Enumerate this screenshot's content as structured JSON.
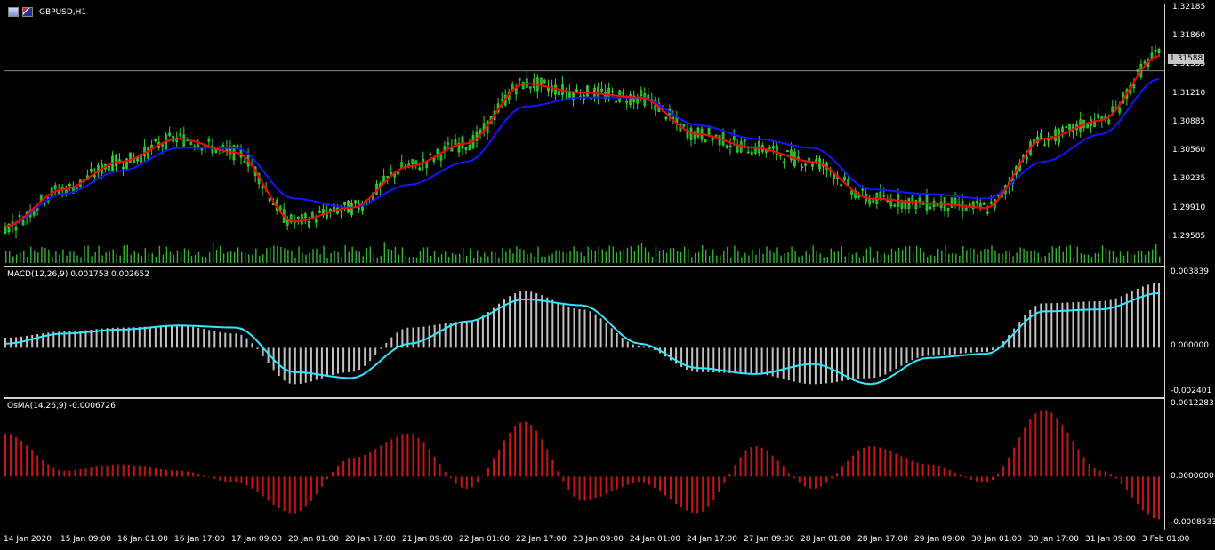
{
  "header": {
    "symbol_label": "GBPUSD,H1"
  },
  "icons": [
    "chart-window-icon",
    "uk-flag-icon"
  ],
  "colors": {
    "background": "#000000",
    "bull": "#33d633",
    "ma_fast": "#ff0000",
    "ma_slow": "#1515ff",
    "volume": "#2fb52f",
    "macd_hist": "#c0c0c0",
    "macd_signal": "#33e6ff",
    "osma": "#c81414",
    "grid_frame": "#d0d0d0"
  },
  "price_panel": {
    "current_price": "1.31588",
    "ticks": [
      "1.32185",
      "1.31860",
      "1.31535",
      "1.31210",
      "1.30885",
      "1.30560",
      "1.30235",
      "1.29910",
      "1.29585"
    ]
  },
  "macd_panel": {
    "title": "MACD(12,26,9) 0.001753 0.002652",
    "ticks": [
      "0.003839",
      "0.000000",
      "-0.002401"
    ]
  },
  "osma_panel": {
    "title": "OsMA(14,26,9) -0.0006726",
    "ticks": [
      "0.0012283",
      "0.0000000",
      "-0.0008533"
    ]
  },
  "time_axis": [
    "14 Jan 2020",
    "15 Jan 09:00",
    "16 Jan 01:00",
    "16 Jan 17:00",
    "17 Jan 09:00",
    "20 Jan 01:00",
    "20 Jan 17:00",
    "21 Jan 09:00",
    "22 Jan 01:00",
    "22 Jan 17:00",
    "23 Jan 09:00",
    "24 Jan 01:00",
    "24 Jan 17:00",
    "27 Jan 09:00",
    "28 Jan 01:00",
    "28 Jan 17:00",
    "29 Jan 09:00",
    "30 Jan 01:00",
    "30 Jan 17:00",
    "31 Jan 09:00",
    "3 Feb 01:00"
  ],
  "chart_data": [
    {
      "type": "line",
      "title": "GBPUSD,H1",
      "ylim": [
        1.295,
        1.323
      ],
      "x": [
        "14 Jan 2020",
        "15 Jan 09:00",
        "16 Jan 01:00",
        "16 Jan 17:00",
        "17 Jan 09:00",
        "20 Jan 01:00",
        "20 Jan 17:00",
        "21 Jan 09:00",
        "22 Jan 01:00",
        "22 Jan 17:00",
        "23 Jan 09:00",
        "24 Jan 01:00",
        "24 Jan 17:00",
        "27 Jan 09:00",
        "28 Jan 01:00",
        "28 Jan 17:00",
        "29 Jan 09:00",
        "30 Jan 01:00",
        "30 Jan 17:00",
        "31 Jan 09:00",
        "3 Feb 01:00"
      ],
      "series": [
        {
          "values": [
            1.299,
            1.303,
            1.306,
            1.3085,
            1.307,
            1.2995,
            1.301,
            1.3055,
            1.308,
            1.3145,
            1.3135,
            1.313,
            1.309,
            1.3075,
            1.306,
            1.302,
            1.3015,
            1.301,
            1.3085,
            1.3105,
            1.3175
          ]
        },
        {
          "values": [
            1.299,
            1.3025,
            1.305,
            1.3075,
            1.3075,
            1.302,
            1.301,
            1.3035,
            1.306,
            1.312,
            1.313,
            1.313,
            1.31,
            1.3085,
            1.3075,
            1.303,
            1.3025,
            1.302,
            1.306,
            1.309,
            1.315
          ]
        }
      ]
    },
    {
      "type": "bar",
      "title": "MACD(12,26,9) 0.001753 0.002652",
      "ylim": [
        -0.002401,
        0.003839
      ],
      "categories": [
        "14 Jan 2020",
        "15 Jan 09:00",
        "16 Jan 01:00",
        "16 Jan 17:00",
        "17 Jan 09:00",
        "20 Jan 01:00",
        "20 Jan 17:00",
        "21 Jan 09:00",
        "22 Jan 01:00",
        "22 Jan 17:00",
        "23 Jan 09:00",
        "24 Jan 01:00",
        "24 Jan 17:00",
        "27 Jan 09:00",
        "28 Jan 01:00",
        "28 Jan 17:00",
        "29 Jan 09:00",
        "30 Jan 01:00",
        "30 Jan 17:00",
        "31 Jan 09:00",
        "3 Feb 01:00"
      ],
      "series": [
        {
          "values": [
            0.0005,
            0.0008,
            0.001,
            0.0011,
            0.0007,
            -0.0018,
            -0.0012,
            0.001,
            0.0013,
            0.0028,
            0.0019,
            0.0001,
            -0.0012,
            -0.0013,
            -0.0018,
            -0.0015,
            -0.0004,
            -0.0002,
            0.0022,
            0.0023,
            0.0032
          ]
        },
        {
          "values": [
            0.0002,
            0.0007,
            0.0009,
            0.0011,
            0.001,
            -0.0012,
            -0.0015,
            0.0002,
            0.0013,
            0.0024,
            0.0021,
            0.0002,
            -0.001,
            -0.0013,
            -0.0008,
            -0.0018,
            -0.0005,
            -0.0003,
            0.0018,
            0.0019,
            0.0027
          ]
        }
      ]
    },
    {
      "type": "bar",
      "title": "OsMA(14,26,9) -0.0006726",
      "ylim": [
        -0.0008533,
        0.0012283
      ],
      "categories": [
        "14 Jan 2020",
        "15 Jan 09:00",
        "16 Jan 01:00",
        "16 Jan 17:00",
        "17 Jan 09:00",
        "20 Jan 01:00",
        "20 Jan 17:00",
        "21 Jan 09:00",
        "22 Jan 01:00",
        "22 Jan 17:00",
        "23 Jan 09:00",
        "24 Jan 01:00",
        "24 Jan 17:00",
        "27 Jan 09:00",
        "28 Jan 01:00",
        "28 Jan 17:00",
        "29 Jan 09:00",
        "30 Jan 01:00",
        "30 Jan 17:00",
        "31 Jan 09:00",
        "3 Feb 01:00"
      ],
      "values": [
        0.0007,
        0.0001,
        0.0002,
        0.0001,
        -0.0001,
        -0.0006,
        0.0003,
        0.0007,
        -0.0002,
        0.0009,
        -0.0004,
        -0.0001,
        -0.0006,
        0.0005,
        -0.0002,
        0.0005,
        0.0002,
        -0.0001,
        0.0011,
        0.0001,
        -0.0007
      ]
    }
  ]
}
